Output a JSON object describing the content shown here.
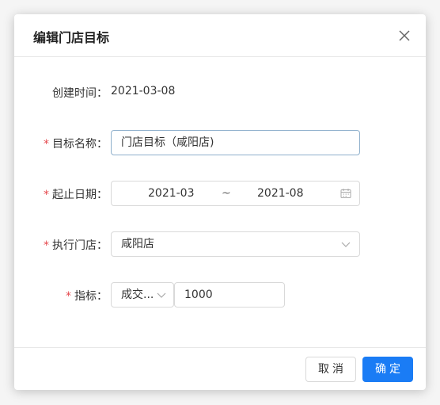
{
  "dialog": {
    "title": "编辑门店目标"
  },
  "form": {
    "created_time_label": "创建时间：",
    "created_time_value": "2021-03-08",
    "target_name_label": "目标名称：",
    "target_name_value": "门店目标（咸阳店)",
    "date_range_label": "起止日期：",
    "date_start": "2021-03",
    "date_separator": "~",
    "date_end": "2021-08",
    "store_label": "执行门店：",
    "store_value": "咸阳店",
    "metric_label": "指标：",
    "metric_type_value": "成交...",
    "metric_amount_value": "1000",
    "required_mark": "*"
  },
  "footer": {
    "cancel_label": "取消",
    "ok_label": "确定"
  },
  "icons": {
    "close": "close-icon",
    "calendar": "calendar-icon",
    "chevron": "chevron-down-icon"
  },
  "colors": {
    "primary": "#1a7cf5",
    "required": "#e5484d"
  }
}
